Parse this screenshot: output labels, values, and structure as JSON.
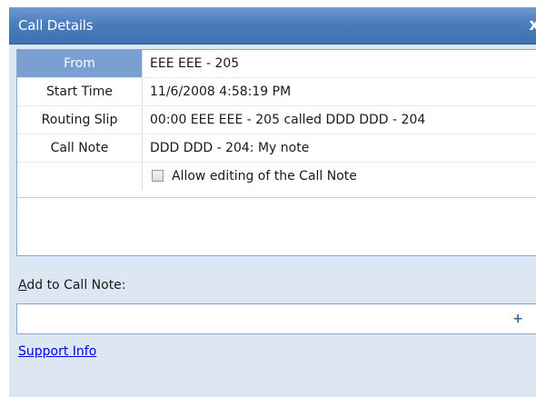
{
  "window": {
    "title": "Call Details",
    "close_glyph": "x"
  },
  "details": {
    "rows": [
      {
        "label": "From",
        "value": "EEE EEE - 205"
      },
      {
        "label": "Start Time",
        "value": "11/6/2008 4:58:19 PM"
      },
      {
        "label": "Routing Slip",
        "value": "00:00 EEE EEE - 205 called DDD DDD - 204"
      },
      {
        "label": "Call Note",
        "value": "DDD DDD - 204: My note"
      }
    ],
    "allow_edit_label": "Allow editing of the Call Note",
    "allow_edit_checked": false
  },
  "add_note": {
    "label_first": "A",
    "label_rest": "dd to Call Note:",
    "value": "",
    "plus_glyph": "+"
  },
  "support_link": "Support Info",
  "colors": {
    "title_bar": "#4b7dbd",
    "selected_row": "#7a9fd1",
    "panel_bg": "#dde7f3",
    "link": "#0000ee"
  }
}
